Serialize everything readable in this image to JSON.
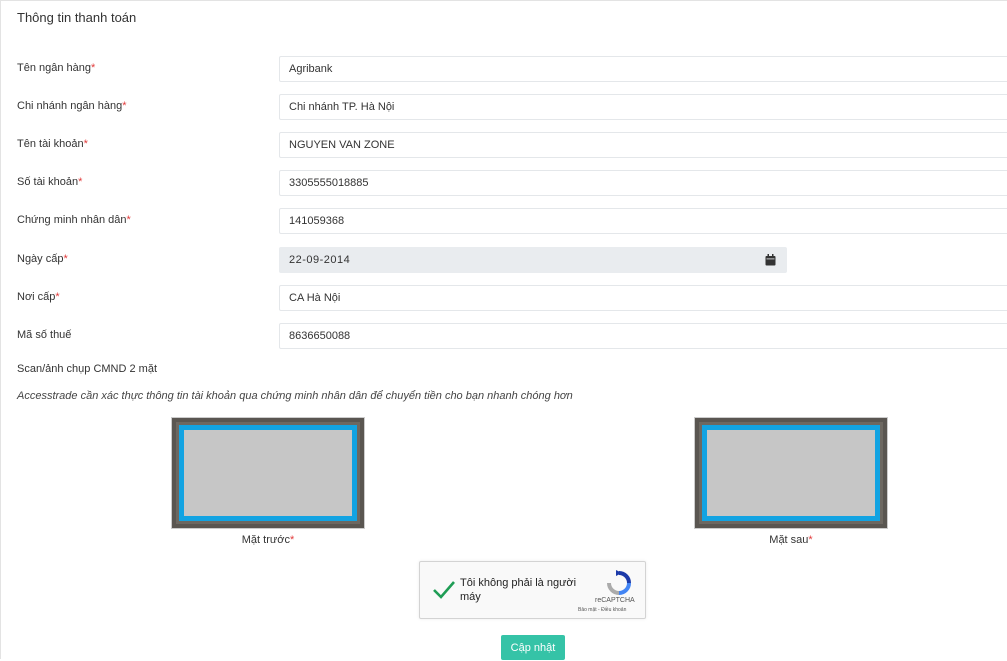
{
  "section_title": "Thông tin thanh toán",
  "required_mark": "*",
  "fields": [
    {
      "label": "Tên ngân hàng",
      "value": "Agribank"
    },
    {
      "label": "Chi nhánh ngân hàng",
      "value": "Chi nhánh TP. Hà Nội"
    },
    {
      "label": "Tên tài khoản",
      "value": "NGUYEN VAN ZONE"
    },
    {
      "label": "Số tài khoản",
      "value": "3305555018885"
    },
    {
      "label": "Chứng minh nhân dân",
      "value": "141059368"
    },
    {
      "label": "Ngày cấp",
      "value": "22-09-2014"
    },
    {
      "label": "Nơi cấp",
      "value": "CA Hà Nội"
    },
    {
      "label": "Mã số thuế",
      "value": "8636650088"
    }
  ],
  "scan": {
    "title": "Scan/ảnh chụp CMND 2 mặt",
    "note": "Accesstrade cần xác thực thông tin tài khoản qua chứng minh nhân dân để chuyển tiền cho bạn nhanh chóng hơn",
    "front_label": "Mặt trước",
    "back_label": "Mặt sau"
  },
  "captcha": {
    "text": "Tôi không phải là người máy",
    "brand": "reCAPTCHA",
    "links": "Bảo mật - Điều khoản"
  },
  "update_button": "Cập nhật",
  "colors": {
    "accent": "#35c3a7",
    "required": "#e23b3b",
    "id_frame": "#12a3e2"
  },
  "icons": {
    "date": "calendar-icon",
    "captcha_check": "checkmark-icon",
    "captcha_logo": "recaptcha-icon"
  }
}
